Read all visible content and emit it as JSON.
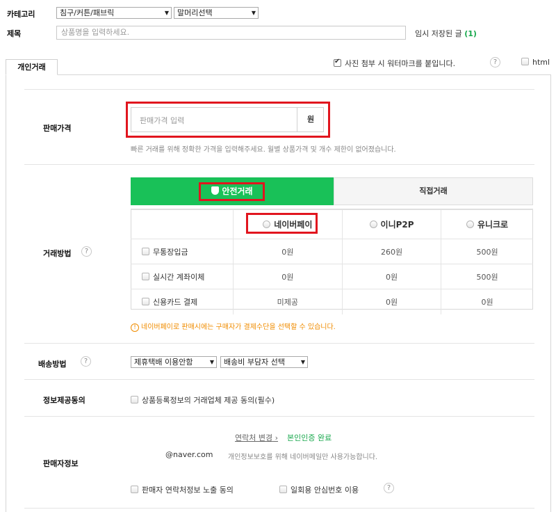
{
  "top": {
    "category_label": "카테고리",
    "category_1": "침구/커튼/패브릭",
    "category_2": "말머리선택",
    "title_label": "제목",
    "title_placeholder": "상품명을 입력하세요.",
    "temp_saved_text": "임시 저장된 글",
    "temp_saved_count": "(1)"
  },
  "tab": {
    "label": "개인거래"
  },
  "options": {
    "watermark_label": "사진 첨부 시 워터마크를 붙입니다.",
    "html_label": "html"
  },
  "price": {
    "label": "판매가격",
    "placeholder": "판매가격 입력",
    "unit": "원",
    "hint": "빠른 거래를 위해 정확한 가격을 입력해주세요. 월별 상품가격 및 개수 제한이 없어졌습니다."
  },
  "trade": {
    "label": "거래방법",
    "tab_safe": "안전거래",
    "tab_direct": "직접거래",
    "providers": [
      "네이버페이",
      "이니P2P",
      "유니크로"
    ],
    "rows": [
      {
        "label": "무통장입금",
        "values": [
          "0원",
          "260원",
          "500원"
        ]
      },
      {
        "label": "실시간 계좌이체",
        "values": [
          "0원",
          "0원",
          "500원"
        ]
      },
      {
        "label": "신용카드 결제",
        "values": [
          "미제공",
          "0원",
          "0원"
        ]
      }
    ],
    "notice": "네이버페이로 판매시에는 구매자가 결제수단을 선택할 수 있습니다."
  },
  "shipping": {
    "label": "배송방법",
    "option_1": "제휴택배 이용안함",
    "option_2": "배송비 부담자 선택"
  },
  "consent": {
    "label": "정보제공동의",
    "checkbox": "상품등록정보의 거래업체 제공 동의(필수)"
  },
  "seller": {
    "label": "판매자정보",
    "change_contact": "연락처 변경",
    "verified": "본인인증 완료",
    "email": "@naver.com",
    "email_note": "개인정보보호를 위해 네이버메일만 사용가능합니다.",
    "contact_consent": "판매자 연락처정보 노출 동의",
    "safe_number": "일회용 안심번호 이용"
  },
  "colors": {
    "green": "#19c158",
    "highlight": "#e1151e",
    "notice": "#f08c00",
    "verified": "#19a84d"
  }
}
